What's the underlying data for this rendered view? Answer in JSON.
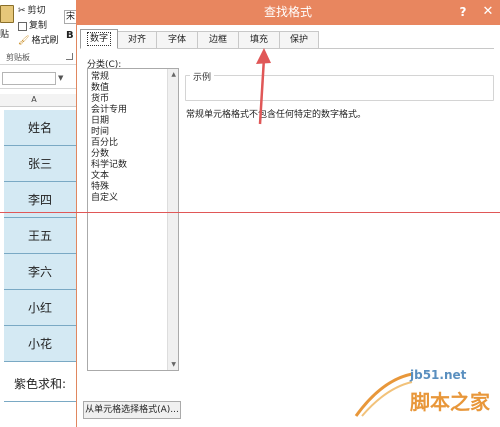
{
  "ribbon": {
    "paste_label": "贴",
    "cut_label": "剪切",
    "copy_label": "复制",
    "format_painter_label": "格式刷",
    "clipboard_group": "剪贴板",
    "font_box_value": "宋",
    "bold_label": "B"
  },
  "sheet": {
    "column_header": "A",
    "cells": [
      "姓名",
      "张三",
      "李四",
      "王五",
      "李六",
      "小红",
      "小花",
      "紫色求和:"
    ]
  },
  "dialog": {
    "title": "查找格式",
    "help": "?",
    "close": "✕",
    "tabs": [
      {
        "label": "数字",
        "active": true
      },
      {
        "label": "对齐",
        "active": false
      },
      {
        "label": "字体",
        "active": false
      },
      {
        "label": "边框",
        "active": false
      },
      {
        "label": "填充",
        "active": false
      },
      {
        "label": "保护",
        "active": false
      }
    ],
    "category_label": "分类(C):",
    "categories": [
      "常规",
      "数值",
      "货币",
      "会计专用",
      "日期",
      "时间",
      "百分比",
      "分数",
      "科学记数",
      "文本",
      "特殊",
      "自定义"
    ],
    "sample_label": "示例",
    "description": "常规单元格格式不包含任何特定的数字格式。",
    "choose_from_cell_button": "从单元格选择格式(A)..."
  },
  "watermark": {
    "line1": "jb51.net",
    "line2": "脚本之家"
  },
  "colors": {
    "titlebar": "#e8865f",
    "cell_blue": "#d4e9f3",
    "annotation_red": "#e05757"
  }
}
